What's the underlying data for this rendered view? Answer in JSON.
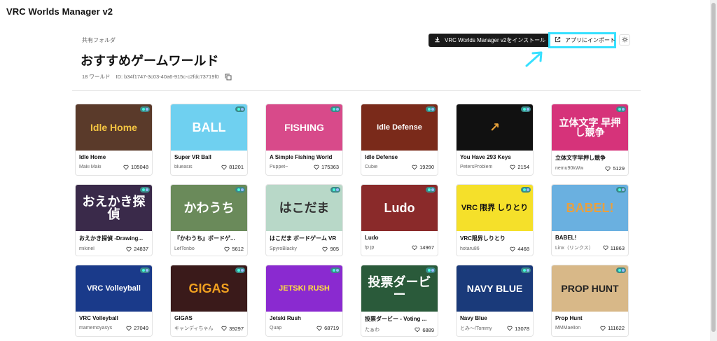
{
  "app": {
    "title": "VRC Worlds Manager v2"
  },
  "header": {
    "breadcrumb": "共有フォルダ",
    "title": "おすすめゲームワールド",
    "world_count": "18 ワールド",
    "folder_id": "ID: b34f1747-3c03-40a6-915c-c2fdc73719f0",
    "install_label": "VRC Worlds Manager v2をインストール",
    "import_label": "アプリにインポート"
  },
  "colors": {
    "highlight": "#37e0ff",
    "arrow": "#37e0ff",
    "install_bg": "#1a1a1a"
  },
  "worlds": [
    {
      "name": "Idle Home",
      "author": "Maki Maki",
      "likes": "105048",
      "art": "Idle Home",
      "bg": "#5a3a2a",
      "fg": "#f5c542"
    },
    {
      "name": "Super VR Ball",
      "author": "blueasis",
      "likes": "81201",
      "art": "BALL",
      "bg": "#6fd0f0",
      "fg": "#ffffff"
    },
    {
      "name": "A Simple Fishing World",
      "author": "Puppet~",
      "likes": "175363",
      "art": "FISHING",
      "bg": "#d84a8a",
      "fg": "#ffffff"
    },
    {
      "name": "Idle Defense",
      "author": "Cubie",
      "likes": "19290",
      "art": "Idle Defense",
      "bg": "#7a2a1a",
      "fg": "#ffffff"
    },
    {
      "name": "You Have 293 Keys",
      "author": "PetersProblem",
      "likes": "2154",
      "art": "↗",
      "bg": "#111111",
      "fg": "#e8a23a"
    },
    {
      "name": "立体文字早押し競争",
      "author": "nemu90kWw",
      "likes": "5129",
      "art": "立体文字 早押し競争",
      "bg": "#d6337a",
      "fg": "#ffffff"
    },
    {
      "name": "おえかき探偵 -Drawing...",
      "author": "mikinel",
      "likes": "24837",
      "art": "おえかき探偵",
      "bg": "#3a2a4a",
      "fg": "#ffffff"
    },
    {
      "name": "『かわうち』ボードゲ...",
      "author": "LefTonbo",
      "likes": "5612",
      "art": "かわうち",
      "bg": "#6a8a5a",
      "fg": "#ffffff"
    },
    {
      "name": "はこだま ボードゲーム VR",
      "author": "SpyroBlacky",
      "likes": "905",
      "art": "はこだま",
      "bg": "#b8d8c8",
      "fg": "#333333"
    },
    {
      "name": "Ludo",
      "author": "tp jp",
      "likes": "14967",
      "art": "Ludo",
      "bg": "#8a2a2a",
      "fg": "#ffffff"
    },
    {
      "name": "VRC限界しりとり",
      "author": "hotaru86",
      "likes": "4468",
      "art": "VRC 限界 しりとり",
      "bg": "#f5e02a",
      "fg": "#111111"
    },
    {
      "name": "BABEL!",
      "author": "Linx（リンクス）",
      "likes": "11863",
      "art": "BABEL!",
      "bg": "#6ab0e0",
      "fg": "#e8a040"
    },
    {
      "name": "VRC Volleyball",
      "author": "mamemoyasys",
      "likes": "27049",
      "art": "VRC Volleyball",
      "bg": "#1a3a8a",
      "fg": "#ffffff"
    },
    {
      "name": "GIGAS",
      "author": "キャンディちゃん",
      "likes": "39297",
      "art": "GIGAS",
      "bg": "#3a1a1a",
      "fg": "#f0a020"
    },
    {
      "name": "Jetski Rush",
      "author": "Quap",
      "likes": "68719",
      "art": "JETSKI RUSH",
      "bg": "#8a2ad0",
      "fg": "#ffe040"
    },
    {
      "name": "投票ダービー - Voting ...",
      "author": "たぁわ",
      "likes": "6889",
      "art": "投票ダービー",
      "bg": "#2a5a3a",
      "fg": "#ffffff"
    },
    {
      "name": "Navy Blue",
      "author": "とみ〜/Tommy",
      "likes": "13078",
      "art": "NAVY BLUE",
      "bg": "#1a3a7a",
      "fg": "#ffffff"
    },
    {
      "name": "Prop Hunt",
      "author": "MMMaellon",
      "likes": "111622",
      "art": "PROP HUNT",
      "bg": "#d8b888",
      "fg": "#222222"
    }
  ]
}
